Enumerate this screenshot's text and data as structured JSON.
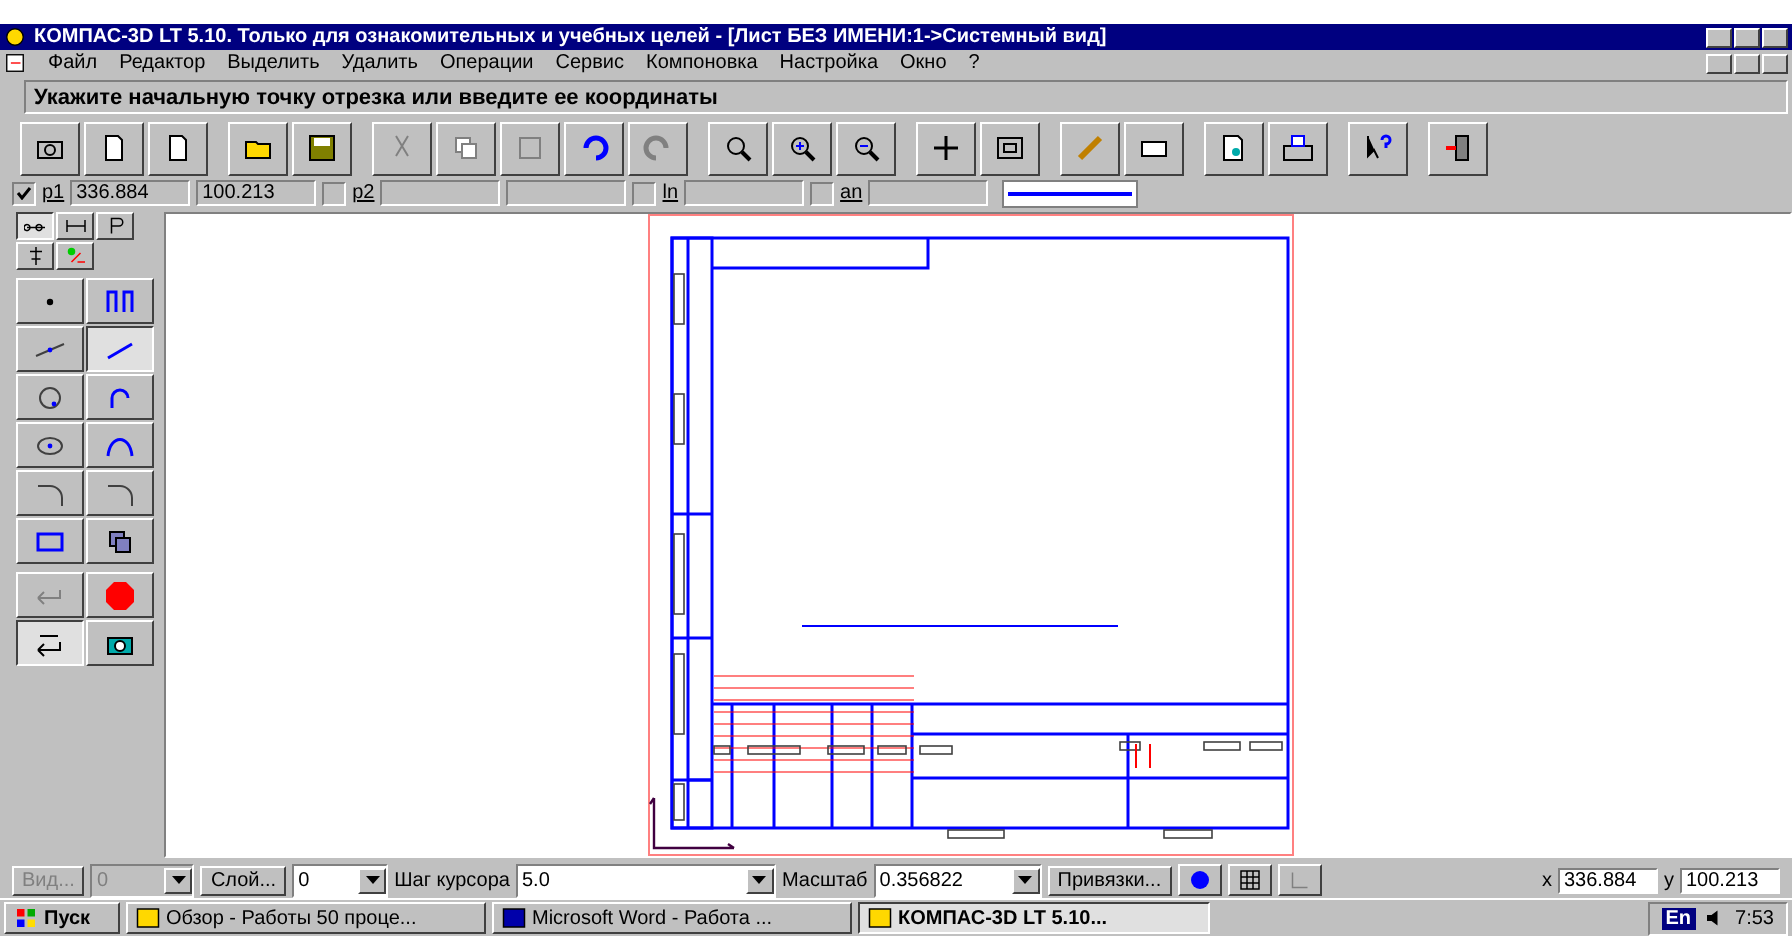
{
  "window": {
    "title": "КОМПАС-3D LT 5.10. Только для ознакомительных и учебных целей - [Лист БЕЗ ИМЕНИ:1->Системный вид]"
  },
  "menu": [
    "Файл",
    "Редактор",
    "Выделить",
    "Удалить",
    "Операции",
    "Сервис",
    "Компоновка",
    "Настройка",
    "Окно",
    "?"
  ],
  "prompt": "Укажите начальную точку отрезка или введите ее координаты",
  "params": [
    {
      "label": "p1",
      "checked": true,
      "values": [
        "336.884",
        "100.213"
      ]
    },
    {
      "label": "p2",
      "checked": false
    },
    {
      "label": "ln",
      "checked": false
    },
    {
      "label": "an",
      "checked": false
    }
  ],
  "palette_tabs": [
    {
      "selected": true
    },
    {
      "selected": false
    },
    {
      "selected": false
    },
    {
      "selected": false
    },
    {
      "selected": false
    }
  ],
  "tools": [
    {
      "kind": "point",
      "selected": false
    },
    {
      "kind": "polyline",
      "selected": false
    },
    {
      "kind": "aux-line",
      "selected": false
    },
    {
      "kind": "segment",
      "selected": true
    },
    {
      "kind": "circle",
      "selected": false
    },
    {
      "kind": "arc",
      "selected": false
    },
    {
      "kind": "ellipse",
      "selected": false
    },
    {
      "kind": "spline",
      "selected": false
    },
    {
      "kind": "fillet",
      "selected": false
    },
    {
      "kind": "chamfer",
      "selected": false
    },
    {
      "kind": "rectangle",
      "selected": false
    },
    {
      "kind": "copy",
      "selected": false
    }
  ],
  "actions": [
    {
      "kind": "enter",
      "selected": false
    },
    {
      "kind": "stop",
      "selected": false
    },
    {
      "kind": "auto",
      "selected": true
    },
    {
      "kind": "camera",
      "selected": false
    }
  ],
  "status": {
    "view_button": "Вид...",
    "view_value": "0",
    "layer_button": "Слой...",
    "layer_value": "0",
    "step_label": "Шаг курсора",
    "step_value": "5.0",
    "scale_label": "Масштаб",
    "scale_value": "0.356822",
    "snap_button": "Привязки...",
    "x_label": "x",
    "x_value": "336.884",
    "y_label": "y",
    "y_value": "100.213"
  },
  "taskbar": {
    "start": "Пуск",
    "tasks": [
      {
        "label": "Обзор - Работы 50 проце...",
        "selected": false
      },
      {
        "label": "Microsoft Word - Работа ...",
        "selected": false
      },
      {
        "label": "КОМПАС-3D LT 5.10...",
        "selected": true
      }
    ],
    "lang": "En",
    "clock": "7:53"
  }
}
